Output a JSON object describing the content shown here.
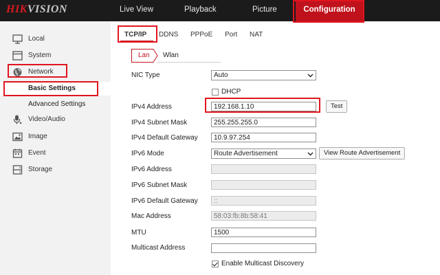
{
  "brand": {
    "logo_red": "HIK",
    "logo_rest": "VISION"
  },
  "topnav": [
    {
      "label": "Live View"
    },
    {
      "label": "Playback"
    },
    {
      "label": "Picture"
    },
    {
      "label": "Configuration",
      "active": true
    }
  ],
  "sidebar": {
    "items": [
      {
        "label": "Local",
        "icon": "monitor-icon"
      },
      {
        "label": "System",
        "icon": "system-window-icon"
      },
      {
        "label": "Network",
        "icon": "globe-icon"
      }
    ],
    "sub": [
      {
        "label": "Basic Settings",
        "active": true
      },
      {
        "label": "Advanced Settings"
      }
    ],
    "items2": [
      {
        "label": "Video/Audio",
        "icon": "microphone-icon"
      },
      {
        "label": "Image",
        "icon": "image-icon"
      },
      {
        "label": "Event",
        "icon": "calendar-icon"
      },
      {
        "label": "Storage",
        "icon": "storage-icon"
      }
    ]
  },
  "tabs": [
    {
      "label": "TCP/IP",
      "active": true
    },
    {
      "label": "DDNS"
    },
    {
      "label": "PPPoE"
    },
    {
      "label": "Port"
    },
    {
      "label": "NAT"
    }
  ],
  "subtabs": [
    {
      "label": "Lan",
      "active": true
    },
    {
      "label": "Wlan"
    }
  ],
  "form": {
    "nic_type": {
      "label": "NIC Type",
      "value": "Auto"
    },
    "dhcp": {
      "label": "DHCP",
      "checked": false
    },
    "ipv4_address": {
      "label": "IPv4 Address",
      "value": "192.168.1.10"
    },
    "test_button": "Test",
    "ipv4_mask": {
      "label": "IPv4 Subnet Mask",
      "value": "255.255.255.0"
    },
    "ipv4_gateway": {
      "label": "IPv4 Default Gateway",
      "value": "10.9.97.254"
    },
    "ipv6_mode": {
      "label": "IPv6 Mode",
      "value": "Route Advertisement"
    },
    "view_route_button": "View Route Advertisement",
    "ipv6_address": {
      "label": "IPv6 Address",
      "value": ""
    },
    "ipv6_mask": {
      "label": "IPv6 Subnet Mask",
      "value": ""
    },
    "ipv6_gateway": {
      "label": "IPv6 Default Gateway",
      "value": "::"
    },
    "mac_address": {
      "label": "Mac Address",
      "value": "58:03:fb:8b:58:41"
    },
    "mtu": {
      "label": "MTU",
      "value": "1500"
    },
    "multicast": {
      "label": "Multicast Address",
      "value": ""
    },
    "multicast_discovery": {
      "label": "Enable Multicast Discovery",
      "checked": true
    }
  },
  "colors": {
    "brand_red": "#c0121c",
    "highlight": "#e0141e",
    "topbar": "#1b1b1b",
    "sidebar": "#f2f2f2"
  }
}
